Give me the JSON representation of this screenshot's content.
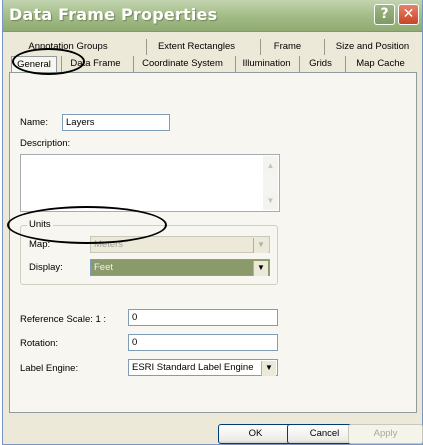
{
  "window": {
    "title": "Data Frame Properties",
    "help_label": "?",
    "close_label": "✕"
  },
  "tabs": {
    "row1": [
      "Annotation Groups",
      "Extent Rectangles",
      "Frame",
      "Size and Position"
    ],
    "row2": [
      "General",
      "Data Frame",
      "Coordinate System",
      "Illumination",
      "Grids",
      "Map Cache"
    ],
    "active": "General"
  },
  "general": {
    "name_label": "Name:",
    "name_value": "Layers",
    "description_label": "Description:",
    "description_value": "",
    "units_group_label": "Units",
    "map_label": "Map:",
    "map_value": "Meters",
    "display_label": "Display:",
    "display_value": "Feet",
    "reference_scale_label": "Reference Scale: 1 :",
    "reference_scale_value": "0",
    "rotation_label": "Rotation:",
    "rotation_value": "0",
    "label_engine_label": "Label Engine:",
    "label_engine_value": "ESRI Standard Label Engine"
  },
  "buttons": {
    "ok": "OK",
    "cancel": "Cancel",
    "apply": "Apply"
  },
  "annotations": [
    "ellipse around General tab",
    "ellipse around Display units"
  ],
  "colors": {
    "titlebar": "#a7bf8b",
    "close": "#c94427",
    "selected_combo": "#8a9a6a",
    "annotation": "#000000"
  }
}
